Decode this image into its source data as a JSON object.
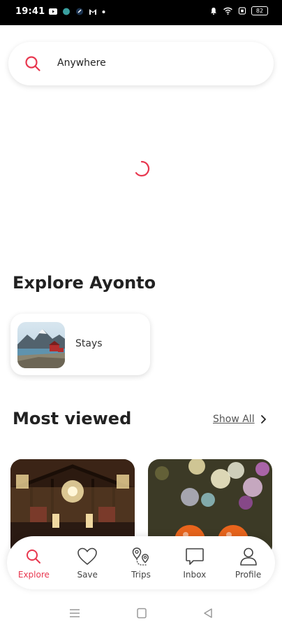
{
  "status_bar": {
    "time": "19:41",
    "battery": "82",
    "left_icons": [
      "youtube-icon",
      "app-icon",
      "app-icon",
      "gmail-icon",
      "dot-icon"
    ],
    "right_icons": [
      "alarm-icon",
      "wifi-icon",
      "sim-icon",
      "battery-icon"
    ]
  },
  "search": {
    "text": "Anywhere",
    "icon": "search-icon"
  },
  "colors": {
    "accent": "#e8374f",
    "text": "#222222",
    "muted": "#555555"
  },
  "explore": {
    "title": "Explore Ayonto",
    "categories": [
      {
        "label": "Stays",
        "icon": "stays-thumbnail"
      }
    ]
  },
  "most_viewed": {
    "title": "Most viewed",
    "show_all_label": "Show All"
  },
  "bottom_nav": {
    "items": [
      {
        "label": "Explore",
        "icon": "search-icon",
        "active": true
      },
      {
        "label": "Save",
        "icon": "heart-icon",
        "active": false
      },
      {
        "label": "Trips",
        "icon": "trips-icon",
        "active": false
      },
      {
        "label": "Inbox",
        "icon": "chat-icon",
        "active": false
      },
      {
        "label": "Profile",
        "icon": "user-icon",
        "active": false
      }
    ]
  },
  "system_nav": [
    "menu-icon",
    "home-icon",
    "back-icon"
  ]
}
